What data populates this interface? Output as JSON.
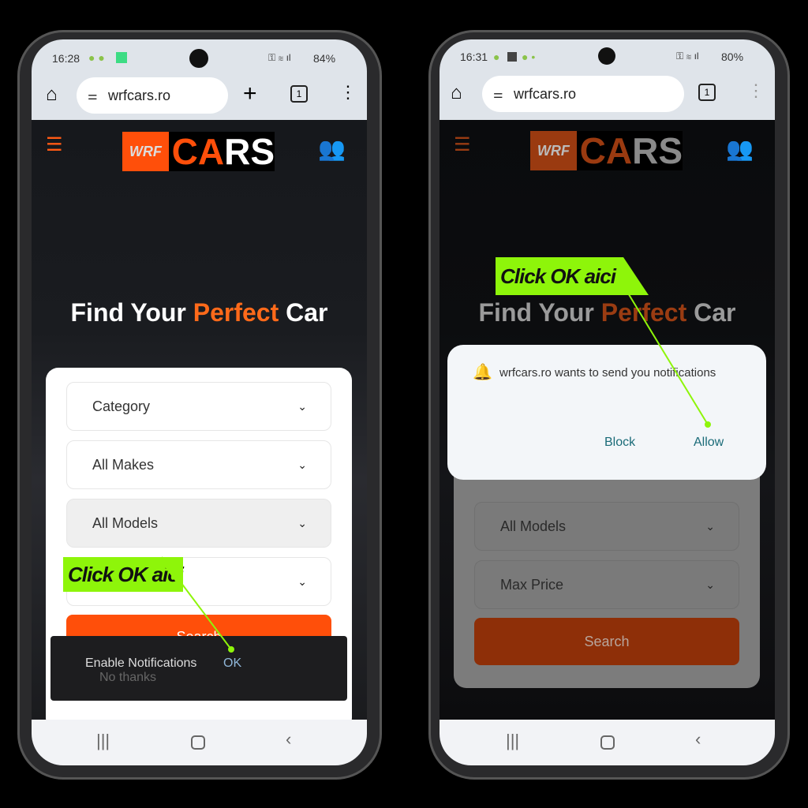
{
  "left": {
    "status": {
      "time": "16:28",
      "battery": "84%"
    },
    "url": "wrfcars.ro",
    "tab_count": "1",
    "logo": {
      "wrf": "WRF",
      "cars_ca": "CA",
      "cars_rs": "RS"
    },
    "headline": {
      "part1": "Find Your ",
      "highlight": "Perfect",
      "part2": " Car"
    },
    "selects": [
      "Category",
      "All Makes",
      "All Models",
      ""
    ],
    "search_label": "Search",
    "toast": {
      "text": "Enable Notifications",
      "ok": "OK",
      "dismiss": "No thanks"
    },
    "callout": "Click OK aici"
  },
  "right": {
    "status": {
      "time": "16:31",
      "battery": "80%"
    },
    "url": "wrfcars.ro",
    "tab_count": "1",
    "logo": {
      "wrf": "WRF",
      "cars_ca": "CA",
      "cars_rs": "RS"
    },
    "headline": {
      "part1": "Find Your ",
      "highlight": "Perfect",
      "part2": " Car"
    },
    "selects": [
      "All Models",
      "Max Price"
    ],
    "search_label": "Search",
    "dialog": {
      "message": "wrfcars.ro wants to send you notifications",
      "block": "Block",
      "allow": "Allow"
    },
    "callout": "Click OK aici"
  },
  "colors": {
    "accent": "#ff4f0a",
    "callout": "#8ef50a",
    "dialog_button": "#1a6b78"
  }
}
